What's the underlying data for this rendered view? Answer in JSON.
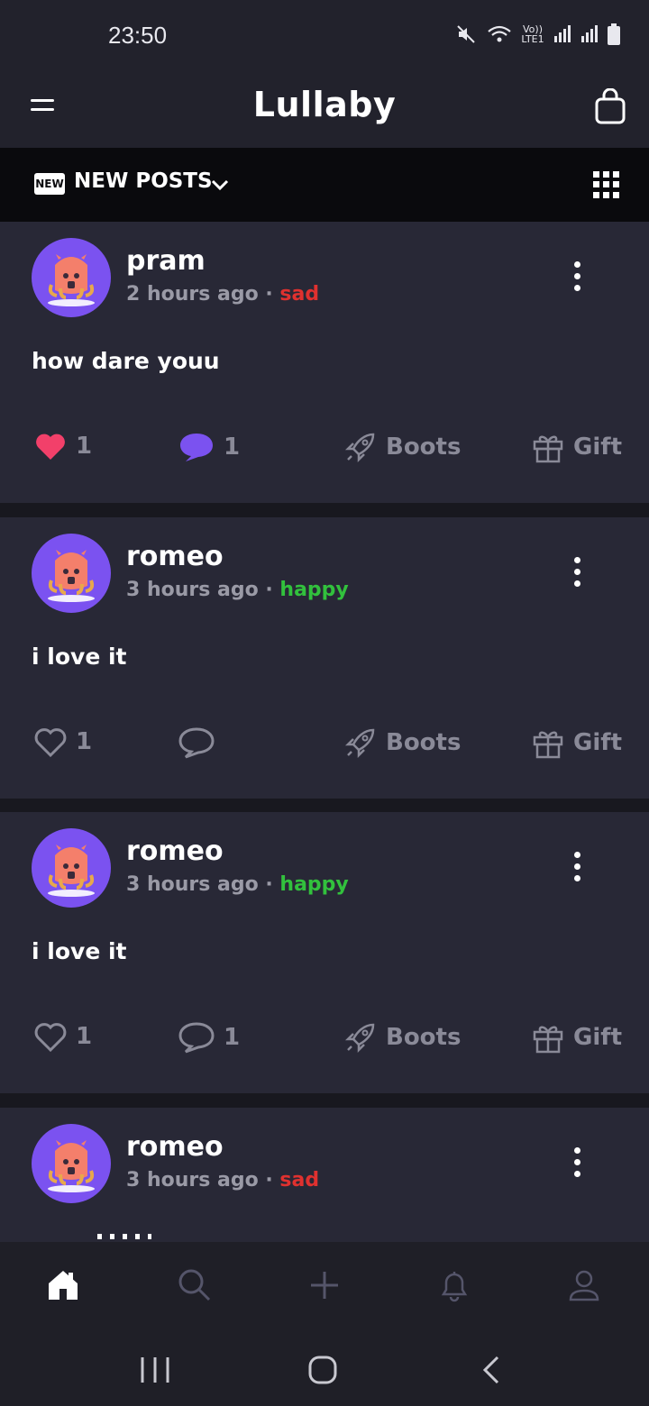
{
  "status_bar": {
    "time": "23:50",
    "icons": [
      "mute-icon",
      "wifi-icon",
      "volte-icon",
      "signal-icon",
      "signal-icon",
      "battery-icon"
    ],
    "volte_label": "Vo)) LTE1"
  },
  "header": {
    "title": "Lullaby",
    "left_icon": "menu-icon",
    "right_icon": "shopping-bag-icon"
  },
  "filter": {
    "badge": "NEW",
    "label": "NEW POSTS",
    "right_icon": "grid-icon"
  },
  "posts": [
    {
      "username": "pram",
      "time": "2 hours ago",
      "separator": "·",
      "mood": "sad",
      "text": "how dare youu",
      "likes": "1",
      "liked": true,
      "comments": "1",
      "commented": true,
      "boost_label": "Boots",
      "gift_label": "Gift"
    },
    {
      "username": "romeo",
      "time": "3 hours ago",
      "separator": "·",
      "mood": "happy",
      "text": "i love it",
      "likes": "1",
      "liked": false,
      "comments": "",
      "commented": false,
      "boost_label": "Boots",
      "gift_label": "Gift"
    },
    {
      "username": "romeo",
      "time": "3 hours ago",
      "separator": "·",
      "mood": "happy",
      "text": "i love it",
      "likes": "1",
      "liked": false,
      "comments": "1",
      "commented": false,
      "boost_label": "Boots",
      "gift_label": "Gift"
    },
    {
      "username": "romeo",
      "time": "3 hours ago",
      "separator": "·",
      "mood": "sad",
      "text": "",
      "likes": "",
      "comments": "",
      "boost_label": "",
      "gift_label": ""
    }
  ],
  "bottom_nav": {
    "items": [
      "home-icon",
      "search-icon",
      "add-icon",
      "bell-icon",
      "profile-icon"
    ],
    "active": "home-icon"
  },
  "system_nav": {
    "items": [
      "recent-apps-icon",
      "home-button-icon",
      "back-icon"
    ]
  },
  "colors": {
    "background": "#25252f",
    "card": "#282836",
    "avatar": "#7b52f0",
    "like": "#f2406a",
    "comment": "#7b52f0",
    "sad": "#e0312f",
    "happy": "#32c13d",
    "muted": "#8a8a98"
  }
}
